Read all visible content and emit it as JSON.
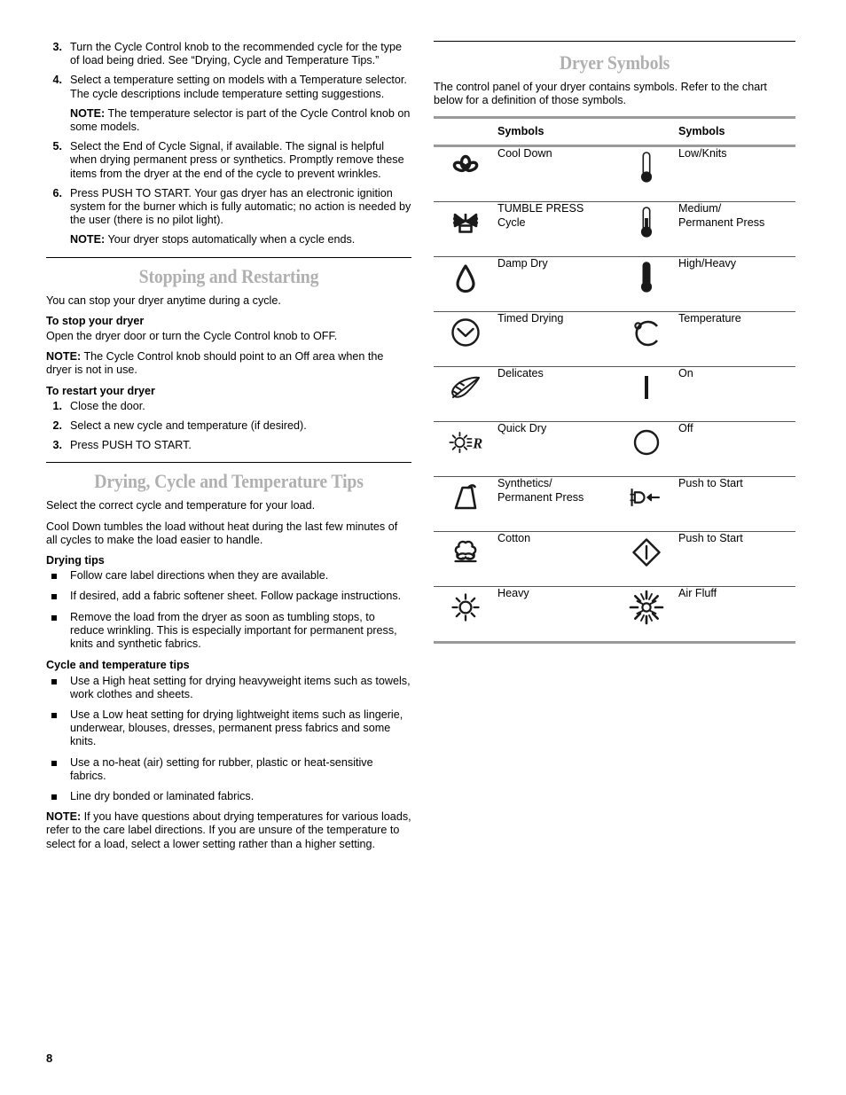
{
  "page_number": "8",
  "left_column": {
    "steps": [
      {
        "num": "3.",
        "text": "Turn the Cycle Control knob to the recommended cycle for the type of load being dried. See  “Drying, Cycle and Temperature Tips.”"
      },
      {
        "num": "4.",
        "text": "Select a temperature setting on models with a Temperature selector. The cycle descriptions include temperature setting suggestions.",
        "note_label": "NOTE:",
        "note_text": " The temperature selector is part of the Cycle Control knob on some models."
      },
      {
        "num": "5.",
        "text": "Select the End of Cycle Signal, if available. The signal is helpful when drying permanent press or synthetics. Promptly remove these items from the dryer at the end of the cycle to prevent wrinkles."
      },
      {
        "num": "6.",
        "text": "Press PUSH TO START. Your gas dryer has an electronic ignition system for the burner which is fully automatic; no action is needed by the user (there is no pilot light).",
        "note_label": "NOTE:",
        "note_text": " Your dryer stops automatically when a cycle ends."
      }
    ],
    "stopping_section": {
      "heading": "Stopping and Restarting",
      "intro": "You can stop your dryer anytime during a cycle.",
      "stop_head": "To stop your dryer",
      "stop_text": "Open the dryer door or turn the Cycle Control knob to OFF.",
      "note_label": "NOTE:",
      "note_text": " The Cycle Control knob should point to an Off area when the dryer is not in use.",
      "restart_head": "To restart your dryer",
      "restart_steps": [
        {
          "num": "1.",
          "text": "Close the door."
        },
        {
          "num": "2.",
          "text": "Select a new cycle and temperature (if desired)."
        },
        {
          "num": "3.",
          "text": "Press PUSH TO START."
        }
      ]
    },
    "tips_section": {
      "heading": "Drying, Cycle and Temperature Tips",
      "intro1": "Select the correct cycle and temperature for your load.",
      "intro2": "Cool Down tumbles the load without heat during the last few minutes of all cycles to make the load easier to handle.",
      "drying_tips_head": "Drying tips",
      "drying_tips": [
        "Follow care label directions when they are available.",
        "If desired, add a fabric softener sheet. Follow package instructions.",
        "Remove the load from the dryer as soon as tumbling stops, to reduce wrinkling. This is especially important for permanent press, knits and synthetic fabrics."
      ],
      "cycle_tips_head": "Cycle and temperature tips",
      "cycle_tips": [
        "Use a High heat setting for drying heavyweight items such as towels, work clothes and sheets.",
        "Use a Low heat setting for drying lightweight items such as lingerie, underwear, blouses, dresses, permanent press fabrics and some knits.",
        "Use a no-heat (air) setting for rubber, plastic or heat-sensitive fabrics.",
        "Line dry bonded or laminated fabrics."
      ],
      "final_note_label": "NOTE:",
      "final_note_text": " If you have questions about drying temperatures for various loads, refer to the care label directions. If you are unsure of the temperature to select for a load, select a lower setting rather than a higher setting."
    }
  },
  "right_column": {
    "heading": "Dryer Symbols",
    "intro": "The control panel of your dryer contains symbols. Refer to the chart below for a definition of those symbols.",
    "table": {
      "headers": [
        "",
        "Symbols",
        "",
        "Symbols"
      ],
      "rows": [
        {
          "left_icon": "fan-cool-down-icon",
          "left_label": "Cool Down",
          "right_icon": "thermometer-low-icon",
          "right_label": "Low/Knits"
        },
        {
          "left_icon": "tumble-press-icon",
          "left_label": "TUMBLE PRESS\nCycle",
          "right_icon": "thermometer-medium-icon",
          "right_label": "Medium/\nPermanent Press"
        },
        {
          "left_icon": "water-droplet-damp-dry-icon",
          "left_label": "Damp Dry",
          "right_icon": "thermometer-high-icon",
          "right_label": "High/Heavy"
        },
        {
          "left_icon": "clock-timed-drying-icon",
          "left_label": "Timed Drying",
          "right_icon": "degrees-celsius-icon",
          "right_label": "Temperature"
        },
        {
          "left_icon": "feather-delicates-icon",
          "left_label": "Delicates",
          "right_icon": "power-on-bar-icon",
          "right_label": "On"
        },
        {
          "left_icon": "sun-r-quick-dry-icon",
          "left_label": "Quick Dry",
          "right_icon": "power-off-circle-icon",
          "right_label": "Off"
        },
        {
          "left_icon": "iron-synthetics-icon",
          "left_label": "Synthetics/\nPermanent Press",
          "right_icon": "plug-push-to-start-icon",
          "right_label": "Push to Start"
        },
        {
          "left_icon": "cotton-boll-icon",
          "left_label": "Cotton",
          "right_icon": "diamond-push-to-start-icon",
          "right_label": "Push to Start"
        },
        {
          "left_icon": "sun-heavy-icon",
          "left_label": "Heavy",
          "right_icon": "starburst-air-fluff-icon",
          "right_label": "Air Fluff"
        }
      ]
    }
  },
  "colors": {
    "heading_gray": "#b0b0b0",
    "table_rule_gray": "#9a9a9a",
    "text_black": "#000000"
  }
}
